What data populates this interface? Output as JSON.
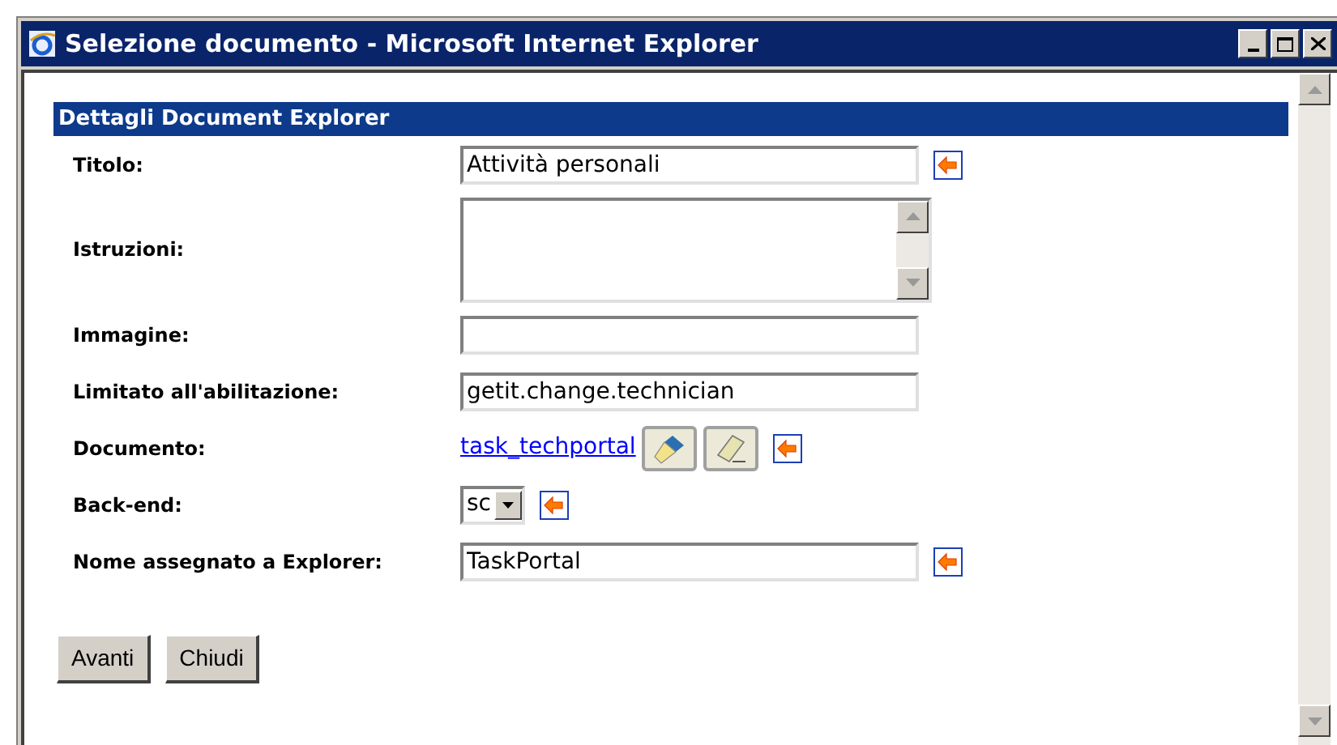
{
  "window": {
    "title": "Selezione documento - Microsoft Internet Explorer"
  },
  "section": {
    "title": "Dettagli Document Explorer"
  },
  "fields": [
    {
      "kind": "text",
      "label": "Titolo:",
      "value": "Attività personali",
      "arrow": true
    },
    {
      "kind": "textarea",
      "label": "Istruzioni:",
      "arrow": false
    },
    {
      "kind": "text",
      "label": "Immagine:",
      "arrow": false
    },
    {
      "kind": "text",
      "label": "Limitato all'abilitazione:",
      "value": "getit.change.technician",
      "arrow": false
    },
    {
      "kind": "link",
      "label": "Documento:",
      "value": "task_techportal",
      "arrow": true
    },
    {
      "kind": "select",
      "label": "Back-end:",
      "value": "sc",
      "arrow": true
    },
    {
      "kind": "text",
      "label": "Nome assegnato a Explorer:",
      "value": "TaskPortal",
      "arrow": true
    }
  ],
  "buttons": [
    "Avanti",
    "Chiudi"
  ]
}
